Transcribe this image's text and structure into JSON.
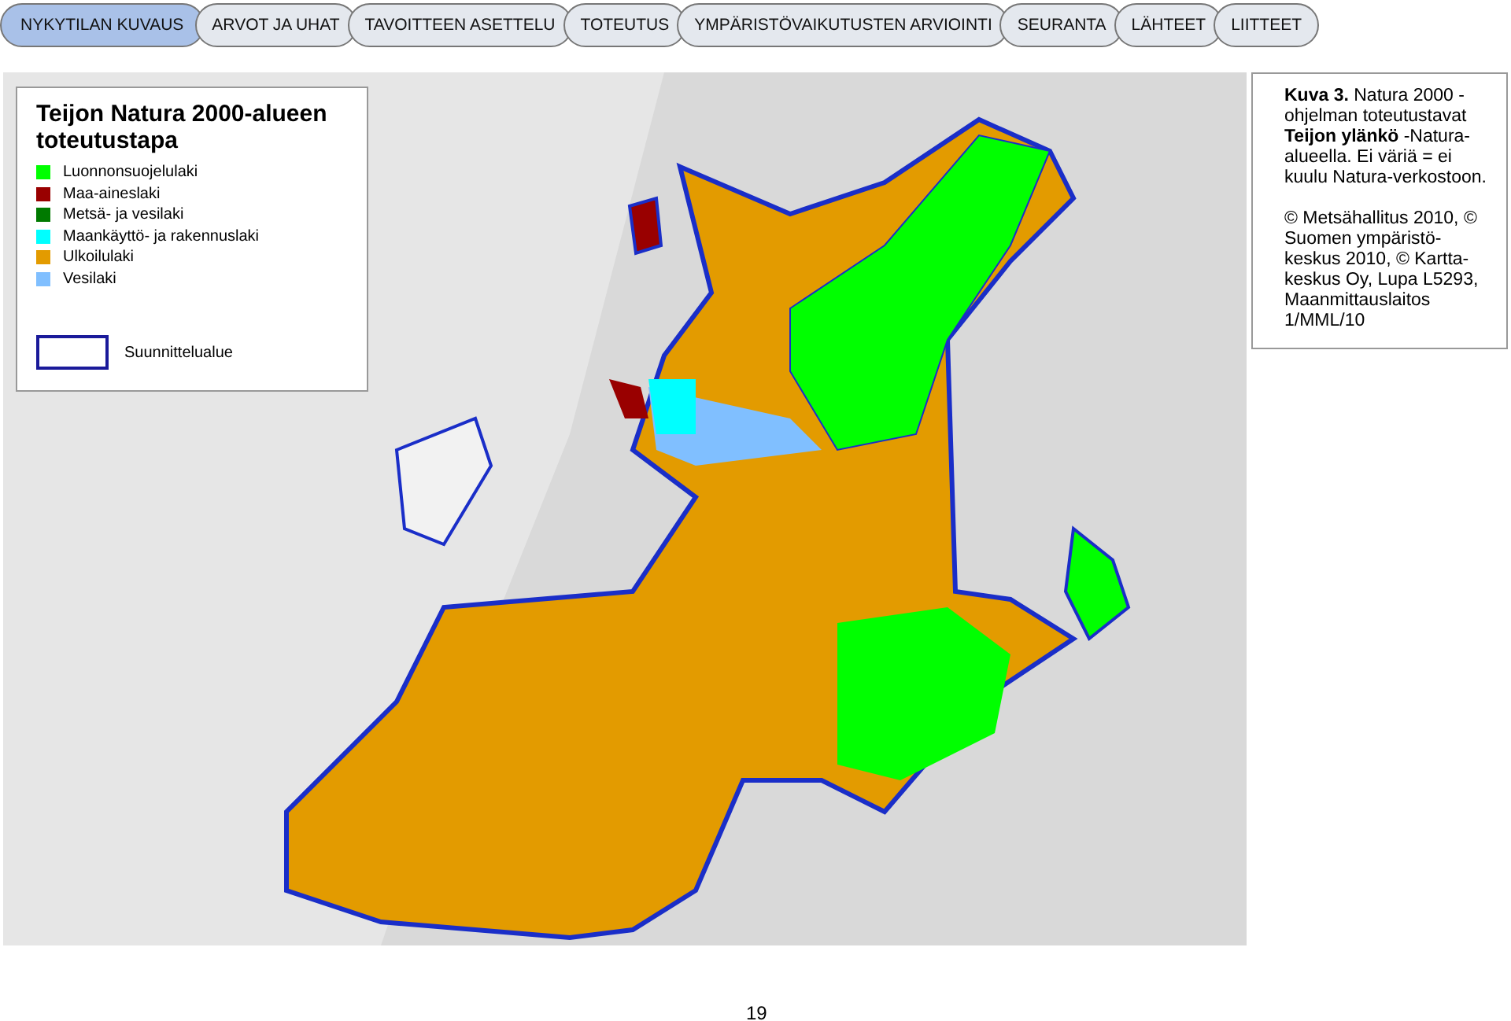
{
  "tabs": [
    {
      "label": "NYKYTILAN KUVAUS",
      "selected": true
    },
    {
      "label": "ARVOT JA UHAT",
      "selected": false
    },
    {
      "label": "TAVOITTEEN ASETTELU",
      "selected": false
    },
    {
      "label": "TOTEUTUS",
      "selected": false
    },
    {
      "label": "YMPÄRISTÖVAIKUTUSTEN ARVIOINTI",
      "selected": false
    },
    {
      "label": "SEURANTA",
      "selected": false
    },
    {
      "label": "LÄHTEET",
      "selected": false
    },
    {
      "label": "LIITTEET",
      "selected": false
    }
  ],
  "legend": {
    "title": "Teijon Natura 2000-alueen toteutustapa",
    "items": [
      {
        "label": "Luonnonsuojelulaki",
        "color": "#00ff00"
      },
      {
        "label": "Maa-aineslaki",
        "color": "#990000"
      },
      {
        "label": "Metsä- ja vesilaki",
        "color": "#007a00"
      },
      {
        "label": "Maankäyttö- ja rakennuslaki",
        "color": "#00ffff"
      },
      {
        "label": "Ulkoilulaki",
        "color": "#e39b00"
      },
      {
        "label": "Vesilaki",
        "color": "#80bfff"
      }
    ],
    "boundary_label": "Suunnittelualue"
  },
  "caption": {
    "description": "**Kuva 3.** Natura 2000 -ohjelman toteutustavat **Teijon ylänkö** -Natura-alueella. Ei väriä = ei kuulu Natura-verkostoon.",
    "credits": "© Metsähallitus 2010, © Suomen ympäristö-keskus 2010, © Kartta-keskus Oy, Lupa L5293, Maanmittauslaitos 1/MML/10"
  },
  "page_number": "19"
}
